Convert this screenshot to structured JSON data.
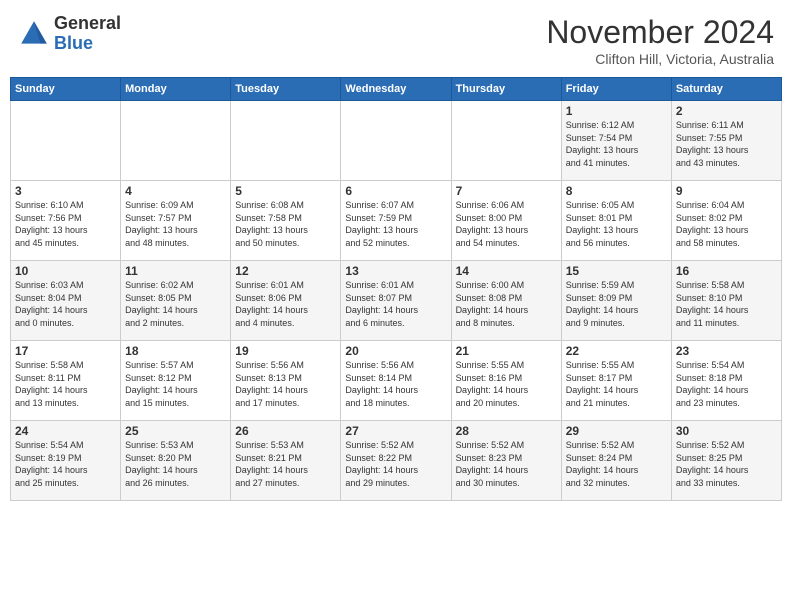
{
  "header": {
    "logo_general": "General",
    "logo_blue": "Blue",
    "month_title": "November 2024",
    "location": "Clifton Hill, Victoria, Australia"
  },
  "calendar": {
    "days_of_week": [
      "Sunday",
      "Monday",
      "Tuesday",
      "Wednesday",
      "Thursday",
      "Friday",
      "Saturday"
    ],
    "weeks": [
      {
        "cells": [
          {
            "day": "",
            "info": ""
          },
          {
            "day": "",
            "info": ""
          },
          {
            "day": "",
            "info": ""
          },
          {
            "day": "",
            "info": ""
          },
          {
            "day": "",
            "info": ""
          },
          {
            "day": "1",
            "info": "Sunrise: 6:12 AM\nSunset: 7:54 PM\nDaylight: 13 hours\nand 41 minutes."
          },
          {
            "day": "2",
            "info": "Sunrise: 6:11 AM\nSunset: 7:55 PM\nDaylight: 13 hours\nand 43 minutes."
          }
        ]
      },
      {
        "cells": [
          {
            "day": "3",
            "info": "Sunrise: 6:10 AM\nSunset: 7:56 PM\nDaylight: 13 hours\nand 45 minutes."
          },
          {
            "day": "4",
            "info": "Sunrise: 6:09 AM\nSunset: 7:57 PM\nDaylight: 13 hours\nand 48 minutes."
          },
          {
            "day": "5",
            "info": "Sunrise: 6:08 AM\nSunset: 7:58 PM\nDaylight: 13 hours\nand 50 minutes."
          },
          {
            "day": "6",
            "info": "Sunrise: 6:07 AM\nSunset: 7:59 PM\nDaylight: 13 hours\nand 52 minutes."
          },
          {
            "day": "7",
            "info": "Sunrise: 6:06 AM\nSunset: 8:00 PM\nDaylight: 13 hours\nand 54 minutes."
          },
          {
            "day": "8",
            "info": "Sunrise: 6:05 AM\nSunset: 8:01 PM\nDaylight: 13 hours\nand 56 minutes."
          },
          {
            "day": "9",
            "info": "Sunrise: 6:04 AM\nSunset: 8:02 PM\nDaylight: 13 hours\nand 58 minutes."
          }
        ]
      },
      {
        "cells": [
          {
            "day": "10",
            "info": "Sunrise: 6:03 AM\nSunset: 8:04 PM\nDaylight: 14 hours\nand 0 minutes."
          },
          {
            "day": "11",
            "info": "Sunrise: 6:02 AM\nSunset: 8:05 PM\nDaylight: 14 hours\nand 2 minutes."
          },
          {
            "day": "12",
            "info": "Sunrise: 6:01 AM\nSunset: 8:06 PM\nDaylight: 14 hours\nand 4 minutes."
          },
          {
            "day": "13",
            "info": "Sunrise: 6:01 AM\nSunset: 8:07 PM\nDaylight: 14 hours\nand 6 minutes."
          },
          {
            "day": "14",
            "info": "Sunrise: 6:00 AM\nSunset: 8:08 PM\nDaylight: 14 hours\nand 8 minutes."
          },
          {
            "day": "15",
            "info": "Sunrise: 5:59 AM\nSunset: 8:09 PM\nDaylight: 14 hours\nand 9 minutes."
          },
          {
            "day": "16",
            "info": "Sunrise: 5:58 AM\nSunset: 8:10 PM\nDaylight: 14 hours\nand 11 minutes."
          }
        ]
      },
      {
        "cells": [
          {
            "day": "17",
            "info": "Sunrise: 5:58 AM\nSunset: 8:11 PM\nDaylight: 14 hours\nand 13 minutes."
          },
          {
            "day": "18",
            "info": "Sunrise: 5:57 AM\nSunset: 8:12 PM\nDaylight: 14 hours\nand 15 minutes."
          },
          {
            "day": "19",
            "info": "Sunrise: 5:56 AM\nSunset: 8:13 PM\nDaylight: 14 hours\nand 17 minutes."
          },
          {
            "day": "20",
            "info": "Sunrise: 5:56 AM\nSunset: 8:14 PM\nDaylight: 14 hours\nand 18 minutes."
          },
          {
            "day": "21",
            "info": "Sunrise: 5:55 AM\nSunset: 8:16 PM\nDaylight: 14 hours\nand 20 minutes."
          },
          {
            "day": "22",
            "info": "Sunrise: 5:55 AM\nSunset: 8:17 PM\nDaylight: 14 hours\nand 21 minutes."
          },
          {
            "day": "23",
            "info": "Sunrise: 5:54 AM\nSunset: 8:18 PM\nDaylight: 14 hours\nand 23 minutes."
          }
        ]
      },
      {
        "cells": [
          {
            "day": "24",
            "info": "Sunrise: 5:54 AM\nSunset: 8:19 PM\nDaylight: 14 hours\nand 25 minutes."
          },
          {
            "day": "25",
            "info": "Sunrise: 5:53 AM\nSunset: 8:20 PM\nDaylight: 14 hours\nand 26 minutes."
          },
          {
            "day": "26",
            "info": "Sunrise: 5:53 AM\nSunset: 8:21 PM\nDaylight: 14 hours\nand 27 minutes."
          },
          {
            "day": "27",
            "info": "Sunrise: 5:52 AM\nSunset: 8:22 PM\nDaylight: 14 hours\nand 29 minutes."
          },
          {
            "day": "28",
            "info": "Sunrise: 5:52 AM\nSunset: 8:23 PM\nDaylight: 14 hours\nand 30 minutes."
          },
          {
            "day": "29",
            "info": "Sunrise: 5:52 AM\nSunset: 8:24 PM\nDaylight: 14 hours\nand 32 minutes."
          },
          {
            "day": "30",
            "info": "Sunrise: 5:52 AM\nSunset: 8:25 PM\nDaylight: 14 hours\nand 33 minutes."
          }
        ]
      }
    ]
  }
}
